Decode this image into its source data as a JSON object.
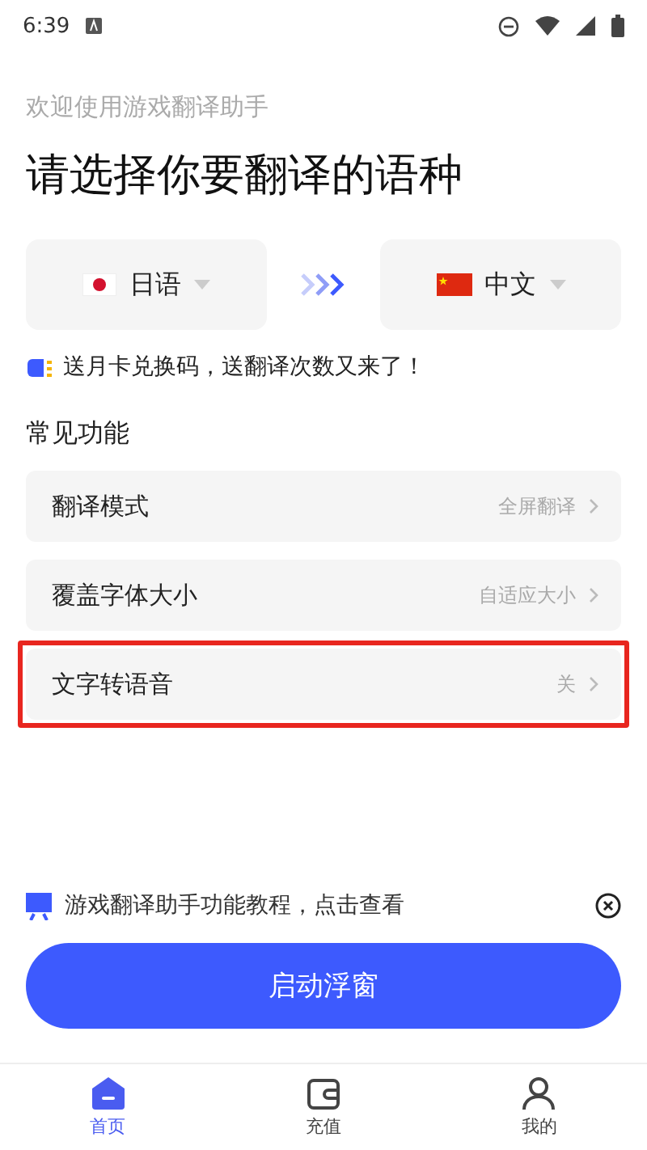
{
  "status_bar": {
    "time": "6:39"
  },
  "subtitle": "欢迎使用游戏翻译助手",
  "title": "请选择你要翻译的语种",
  "languages": {
    "source": {
      "label": "日语"
    },
    "target": {
      "label": "中文"
    }
  },
  "promo": "送月卡兑换码，送翻译次数又来了！",
  "section_title": "常见功能",
  "features": [
    {
      "label": "翻译模式",
      "value": "全屏翻译",
      "highlighted": false
    },
    {
      "label": "覆盖字体大小",
      "value": "自适应大小",
      "highlighted": false
    },
    {
      "label": "文字转语音",
      "value": "关",
      "highlighted": true
    }
  ],
  "tutorial": "游戏翻译助手功能教程，点击查看",
  "start_button": "启动浮窗",
  "nav": [
    {
      "label": "首页",
      "selected": true
    },
    {
      "label": "充值",
      "selected": false
    },
    {
      "label": "我的",
      "selected": false
    }
  ]
}
